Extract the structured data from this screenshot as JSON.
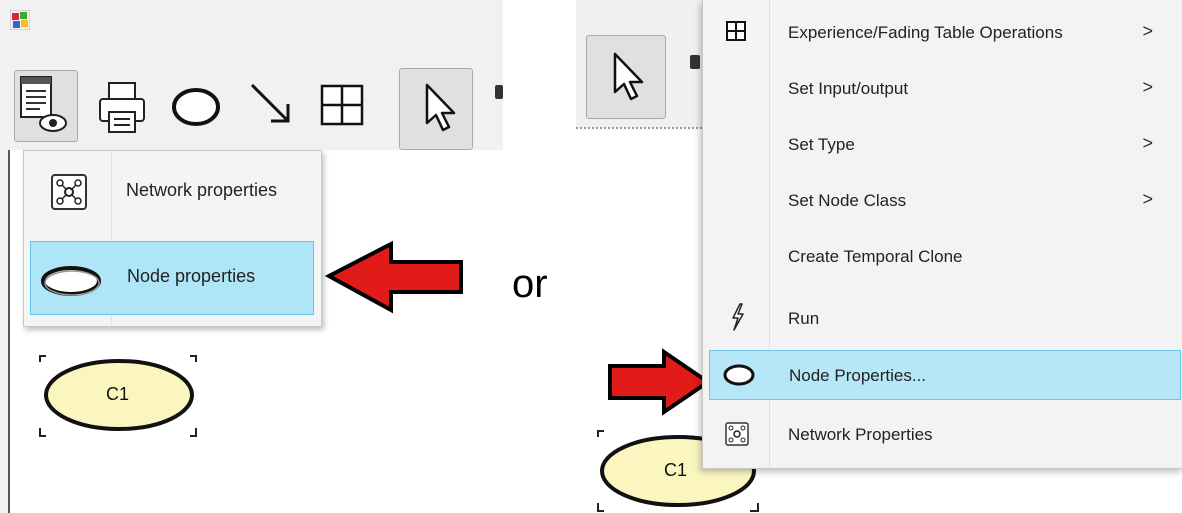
{
  "left": {
    "dropdown": {
      "items": [
        {
          "label": "Network properties"
        },
        {
          "label": "Node properties"
        }
      ]
    },
    "node": {
      "label": "C1"
    }
  },
  "separator_text": "or",
  "right": {
    "context_menu": {
      "items": [
        {
          "label": "Experience/Fading Table Operations",
          "submenu_arrow": ">"
        },
        {
          "label": "Set Input/output",
          "submenu_arrow": ">"
        },
        {
          "label": "Set Type",
          "submenu_arrow": ">"
        },
        {
          "label": "Set Node Class",
          "submenu_arrow": ">"
        },
        {
          "label": "Create Temporal Clone"
        },
        {
          "label": "Run"
        },
        {
          "label": "Node Properties..."
        },
        {
          "label": "Network Properties"
        }
      ]
    },
    "node": {
      "label": "C1"
    }
  },
  "colors": {
    "selection_bg": "#aee6f8",
    "node_fill": "#fbf6c0",
    "arrow_red": "#e11a1a"
  }
}
